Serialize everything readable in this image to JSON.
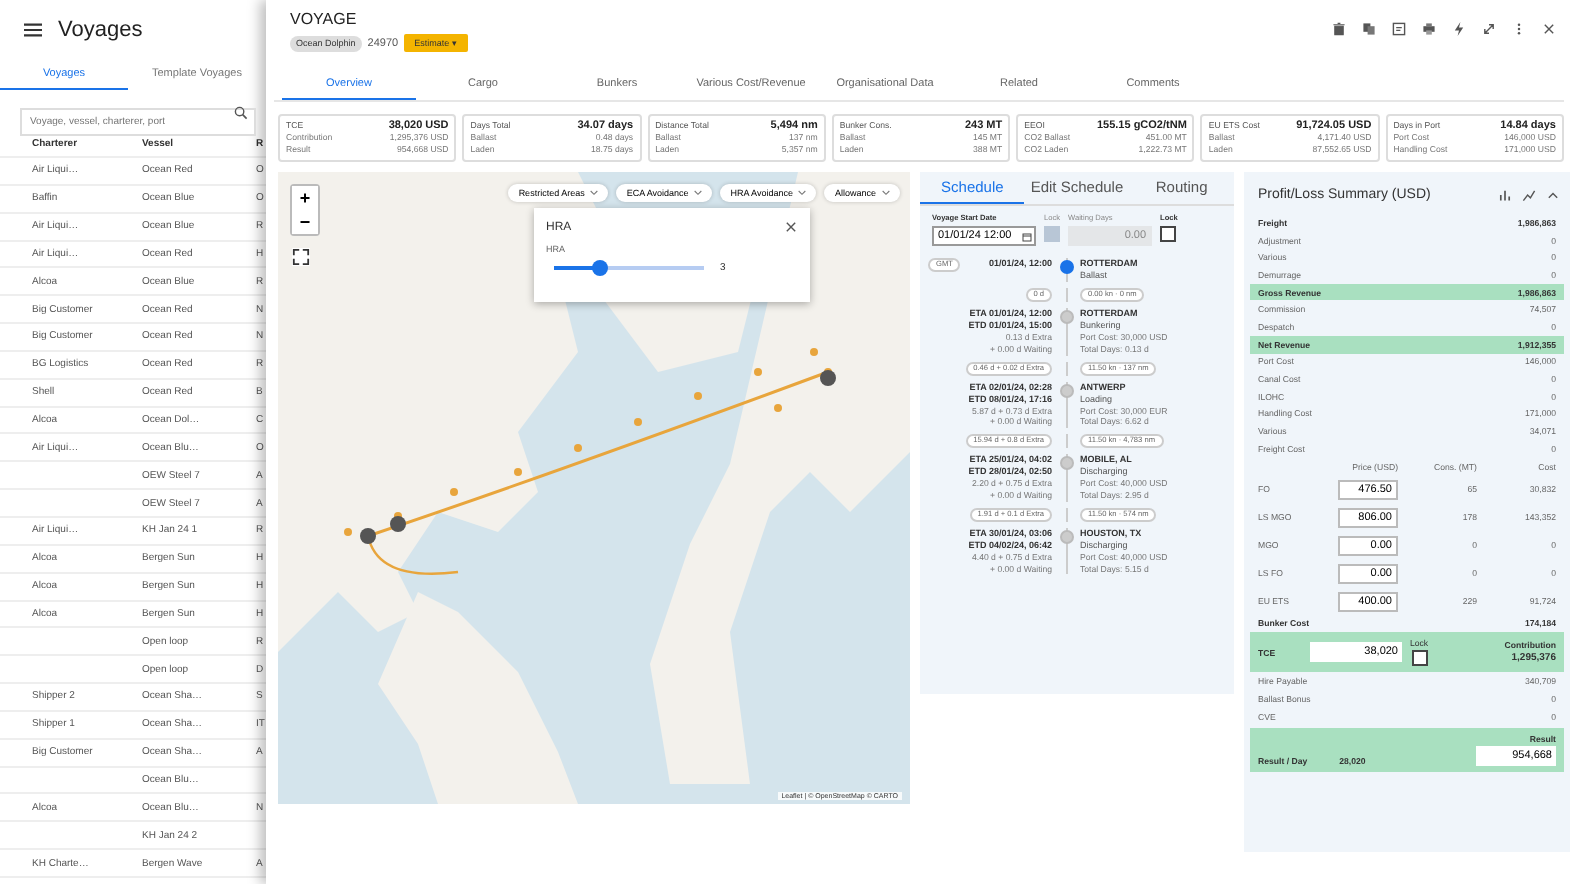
{
  "sidebar": {
    "title": "Voyages",
    "tabs": [
      {
        "label": "Voyages",
        "selected": true
      },
      {
        "label": "Template Voyages",
        "selected": false
      }
    ],
    "search": {
      "placeholder": "Voyage, vessel, charterer, port"
    },
    "columns": [
      "Charterer",
      "Vessel",
      "R"
    ],
    "rows": [
      {
        "charterer": "Air Liqui…",
        "vessel": "Ocean Red",
        "col3": "O"
      },
      {
        "charterer": "Baffin",
        "vessel": "Ocean Blue",
        "col3": "O"
      },
      {
        "charterer": "Air Liqui…",
        "vessel": "Ocean Blue",
        "col3": "R"
      },
      {
        "charterer": "Air Liqui…",
        "vessel": "Ocean Red",
        "col3": "H"
      },
      {
        "charterer": "Alcoa",
        "vessel": "Ocean Blue",
        "col3": "R"
      },
      {
        "charterer": "Big Customer",
        "vessel": "Ocean Red",
        "col3": "N"
      },
      {
        "charterer": "Big Customer",
        "vessel": "Ocean Red",
        "col3": "N"
      },
      {
        "charterer": "BG Logistics",
        "vessel": "Ocean Red",
        "col3": "R"
      },
      {
        "charterer": "Shell",
        "vessel": "Ocean Red",
        "col3": "B"
      },
      {
        "charterer": "Alcoa",
        "vessel": "Ocean Dol…",
        "col3": "C"
      },
      {
        "charterer": "Air Liqui…",
        "vessel": "Ocean Blu…",
        "col3": "O"
      },
      {
        "vessel": "OEW Steel 7",
        "col3": "A"
      },
      {
        "vessel": "OEW Steel 7",
        "col3": "A"
      },
      {
        "charterer": "Air Liqui…",
        "vessel": "KH Jan 24 1",
        "col3": "R"
      },
      {
        "charterer": "Alcoa",
        "vessel": "Bergen Sun",
        "col3": "H"
      },
      {
        "charterer": "Alcoa",
        "vessel": "Bergen Sun",
        "col3": "H"
      },
      {
        "charterer": "Alcoa",
        "vessel": "Bergen Sun",
        "col3": "H"
      },
      {
        "vessel": "Open loop",
        "col3": "R"
      },
      {
        "vessel": "Open loop",
        "col3": "D"
      },
      {
        "charterer": "Shipper 2",
        "vessel": "Ocean Sha…",
        "col3": "S"
      },
      {
        "charterer": "Shipper 1",
        "vessel": "Ocean Sha…",
        "col3": "IT"
      },
      {
        "charterer": "Big Customer",
        "vessel": "Ocean Sha…",
        "col3": "A"
      },
      {
        "vessel": "Ocean Blu…"
      },
      {
        "charterer": "Alcoa",
        "vessel": "Ocean Blu…",
        "col3": "N"
      },
      {
        "vessel": "KH Jan 24 2"
      },
      {
        "charterer": "KH Charte…",
        "vessel": "Bergen Wave",
        "col3": "A"
      }
    ]
  },
  "voyage": {
    "title": "VOYAGE",
    "vessel": "Ocean Dolphin",
    "number": "24970",
    "status": "Estimate",
    "caret": "▾",
    "tabs": [
      {
        "label": "Overview",
        "selected": true
      },
      {
        "label": "Cargo",
        "selected": false
      },
      {
        "label": "Bunkers",
        "selected": false
      },
      {
        "label": "Various Cost/Revenue",
        "selected": false
      },
      {
        "label": "Organisational Data",
        "selected": false
      },
      {
        "label": "Related",
        "selected": false
      },
      {
        "label": "Comments",
        "selected": false
      }
    ],
    "cards": [
      {
        "rows": [
          [
            "TCE",
            "38,020 USD"
          ],
          [
            "Contribution",
            "1,295,376 USD"
          ],
          [
            "Result",
            "954,668 USD"
          ]
        ]
      },
      {
        "rows": [
          [
            "Days Total",
            "34.07 days"
          ],
          [
            "Ballast",
            "0.48 days"
          ],
          [
            "Laden",
            "18.75 days"
          ]
        ]
      },
      {
        "rows": [
          [
            "Distance Total",
            "5,494 nm"
          ],
          [
            "Ballast",
            "137 nm"
          ],
          [
            "Laden",
            "5,357 nm"
          ]
        ]
      },
      {
        "rows": [
          [
            "Bunker Cons.",
            "243 MT"
          ],
          [
            "Ballast",
            "145 MT"
          ],
          [
            "Laden",
            "388 MT"
          ]
        ]
      },
      {
        "rows": [
          [
            "EEOI",
            "155.15 gCO2/tNM"
          ],
          [
            "CO2 Ballast",
            "451.00 MT"
          ],
          [
            "CO2 Laden",
            "1,222.73 MT"
          ]
        ]
      },
      {
        "rows": [
          [
            "EU ETS Cost",
            "91,724.05 USD"
          ],
          [
            "Ballast",
            "4,171.40 USD"
          ],
          [
            "Laden",
            "87,552.65 USD"
          ]
        ]
      },
      {
        "rows": [
          [
            "Days in Port",
            "14.84 days"
          ],
          [
            "Port Cost",
            "146,000 USD"
          ],
          [
            "Handling Cost",
            "171,000 USD"
          ]
        ]
      }
    ]
  },
  "map": {
    "zoom_in": "+",
    "zoom_out": "−",
    "filters": [
      "Restricted Areas",
      "ECA Avoidance",
      "HRA Avoidance",
      "Allowance"
    ],
    "popup": {
      "title": "HRA",
      "label": "HRA",
      "level": 0.3,
      "value": "3"
    },
    "attribution": "Leaflet | © OpenStreetMap © CARTO"
  },
  "schedule": {
    "tabs": [
      {
        "label": "Schedule",
        "selected": true
      },
      {
        "label": "Edit Schedule",
        "selected": false
      },
      {
        "label": "Routing",
        "selected": false
      }
    ],
    "start_label": "Voyage Start Date",
    "start_value": "01/01/24 12:00",
    "lock_label": "Lock",
    "start_locked": true,
    "waiting_label": "Waiting Days",
    "waiting_value": "0.00",
    "waiting_lock_label": "Lock",
    "waiting_locked": false,
    "timezone": "GMT",
    "stops": [
      {
        "current": true,
        "times": [
          "01/01/24, 12:00"
        ],
        "port": "ROTTERDAM",
        "activity": "Ballast",
        "leg_time": "0 d",
        "leg_speed": "0.00 kn · 0 nm"
      },
      {
        "current": false,
        "times": [
          "ETA 01/01/24, 12:00",
          "ETD 01/01/24, 15:00"
        ],
        "extra": [
          "0.13 d Extra",
          "+ 0.00 d Waiting"
        ],
        "port": "ROTTERDAM",
        "activity": "Bunkering",
        "details": [
          "Port Cost: 30,000 USD",
          "Total Days: 0.13 d"
        ],
        "leg_time": "0.46 d + 0.02 d Extra",
        "leg_speed": "11.50 kn · 137 nm"
      },
      {
        "current": false,
        "times": [
          "ETA 02/01/24, 02:28",
          "ETD 08/01/24, 17:16"
        ],
        "extra": [
          "5.87 d + 0.73 d Extra",
          "+ 0.00 d Waiting"
        ],
        "port": "ANTWERP",
        "activity": "Loading",
        "details": [
          "Port Cost: 30,000 EUR",
          "Total Days: 6.62 d"
        ],
        "leg_time": "15.94 d + 0.8 d Extra",
        "leg_speed": "11.50 kn · 4,783 nm"
      },
      {
        "current": false,
        "times": [
          "ETA 25/01/24, 04:02",
          "ETD 28/01/24, 02:50"
        ],
        "extra": [
          "2.20 d + 0.75 d Extra",
          "+ 0.00 d Waiting"
        ],
        "port": "MOBILE, AL",
        "activity": "Discharging",
        "details": [
          "Port Cost: 40,000 USD",
          "Total Days: 2.95 d"
        ],
        "leg_time": "1.91 d + 0.1 d Extra",
        "leg_speed": "11.50 kn · 574 nm"
      },
      {
        "current": false,
        "times": [
          "ETA 30/01/24, 03:06",
          "ETD 04/02/24, 06:42"
        ],
        "extra": [
          "4.40 d + 0.75 d Extra",
          "+ 0.00 d Waiting"
        ],
        "port": "HOUSTON, TX",
        "activity": "Discharging",
        "details": [
          "Port Cost: 40,000 USD",
          "Total Days: 5.15 d"
        ]
      }
    ]
  },
  "pnl": {
    "title": "Profit/Loss Summary (USD)",
    "rows": [
      {
        "label": "Freight",
        "value": "1,986,863",
        "kind": "bold"
      },
      {
        "label": "Adjustment",
        "value": "0",
        "kind": "normal"
      },
      {
        "label": "Various",
        "value": "0",
        "kind": "normal"
      },
      {
        "label": "Demurrage",
        "value": "0",
        "kind": "normal"
      },
      {
        "label": "Gross Revenue",
        "value": "1,986,863",
        "kind": "highlight"
      },
      {
        "label": "Commission",
        "value": "74,507",
        "kind": "normal"
      },
      {
        "label": "Despatch",
        "value": "0",
        "kind": "normal"
      },
      {
        "label": "Net Revenue",
        "value": "1,912,355",
        "kind": "highlight"
      },
      {
        "label": "Port Cost",
        "value": "146,000",
        "kind": "normal"
      },
      {
        "label": "Canal Cost",
        "value": "0",
        "kind": "normal"
      },
      {
        "label": "ILOHC",
        "value": "0",
        "kind": "normal"
      },
      {
        "label": "Handling Cost",
        "value": "171,000",
        "kind": "normal"
      },
      {
        "label": "Various",
        "value": "34,071",
        "kind": "normal"
      },
      {
        "label": "Freight Cost",
        "value": "0",
        "kind": "normal"
      }
    ],
    "bunker_headers": [
      "Price (USD)",
      "Cons. (MT)",
      "Cost"
    ],
    "bunkers": [
      {
        "grade": "FO",
        "price": "476.50",
        "cons": "65",
        "cost": "30,832"
      },
      {
        "grade": "LS MGO",
        "price": "806.00",
        "cons": "178",
        "cost": "143,352"
      },
      {
        "grade": "MGO",
        "price": "0.00",
        "cons": "0",
        "cost": "0"
      },
      {
        "grade": "LS FO",
        "price": "0.00",
        "cons": "0",
        "cost": "0"
      },
      {
        "grade": "EU ETS",
        "price": "400.00",
        "cons": "229",
        "cost": "91,724"
      }
    ],
    "bunker_cost": {
      "label": "Bunker Cost",
      "value": "174,184"
    },
    "tce": {
      "label": "TCE",
      "value": "38,020",
      "lock_label": "Lock",
      "locked": false,
      "contribution_label": "Contribution",
      "contribution": "1,295,376"
    },
    "after": [
      {
        "label": "Hire Payable",
        "value": "340,709"
      },
      {
        "label": "Ballast Bonus",
        "value": "0"
      },
      {
        "label": "CVE",
        "value": "0"
      }
    ],
    "result": {
      "per_day_label": "Result / Day",
      "per_day": "28,020",
      "label": "Result",
      "value": "954,668"
    }
  }
}
